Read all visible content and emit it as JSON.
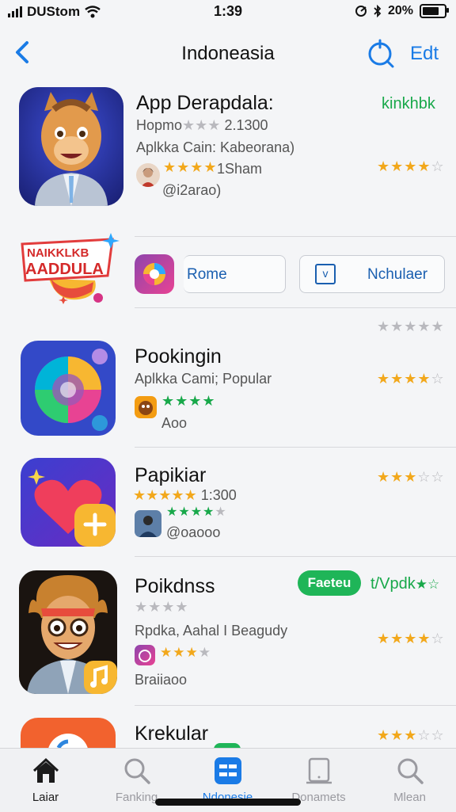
{
  "status_bar": {
    "carrier": "DUStom",
    "time": "1:39",
    "battery": "20%"
  },
  "nav": {
    "title": "Indoneasia",
    "edit_label": "Edt"
  },
  "featured": {
    "name": "App Derapdala:",
    "sub1": "Hopmo",
    "sub1_count": "2.1300",
    "sub2": "Aplkka Cain: Kabeorana)",
    "rating_count": "1Sham",
    "author": "@i2arao)",
    "right_label": "kinkhbk",
    "rating": 4.5
  },
  "promo": {
    "banner_text": "NAIKKLKB AADDULA",
    "button1_label": "Rome",
    "button2_label": "Nchulaer",
    "button2_icon": "v"
  },
  "apps": [
    {
      "name": "Pookingin",
      "sub": "Aplkka Cami; Popular",
      "footer": "Aoo",
      "rating": 4.5
    },
    {
      "name": "Papikiar",
      "sub": "1:300",
      "footer": "@oaooo",
      "rating": 3.5
    },
    {
      "name": "Poikdnss",
      "sub": "Rpdka, Aahal I Beagudy",
      "footer": "Braiiaoo",
      "rating": 4.5,
      "badge": "Faeteu",
      "right_label": "t/Vpdk"
    },
    {
      "name": "Krekular",
      "rating": 3.5
    }
  ],
  "tabs": [
    {
      "label": "Laiar",
      "icon": "home-icon"
    },
    {
      "label": "Fanking",
      "icon": "search-icon"
    },
    {
      "label": "Ndonesie",
      "icon": "grid-icon",
      "active": true
    },
    {
      "label": "Donamets",
      "icon": "tablet-icon"
    },
    {
      "label": "Mlean",
      "icon": "search-icon"
    }
  ],
  "colors": {
    "accent": "#1a7be6",
    "star": "#f2a81c",
    "green": "#18a84a"
  }
}
